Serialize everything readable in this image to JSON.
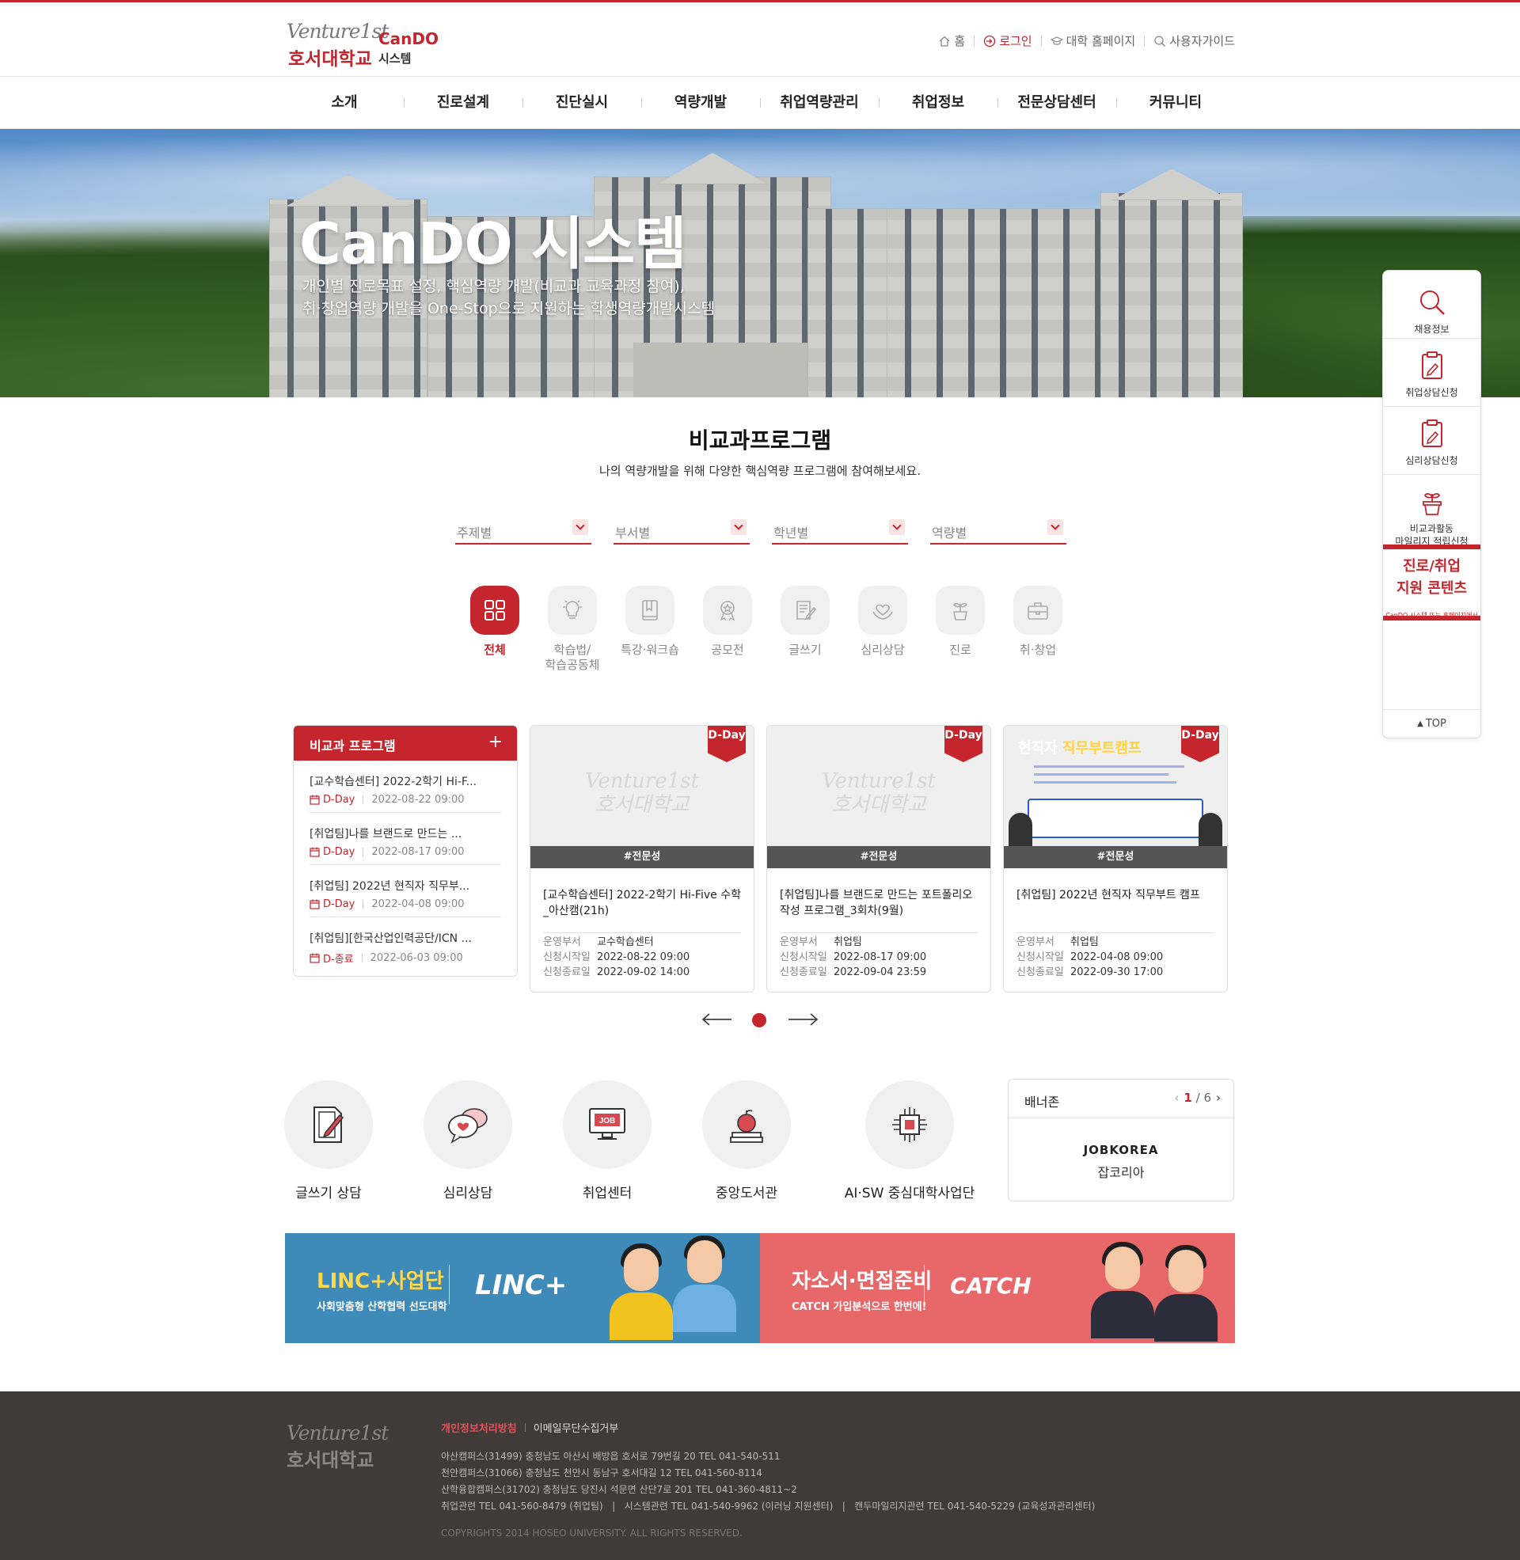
{
  "header": {
    "logo_venture": "Venture1st",
    "logo_univ": "호서대학교",
    "logo_cando": "CanDO",
    "logo_system": "시스템",
    "util": [
      {
        "label": "홈",
        "icon": "home-icon"
      },
      {
        "label": "로그인",
        "icon": "login-icon",
        "active": true
      },
      {
        "label": "대학 홈페이지",
        "icon": "graduation-cap-icon"
      },
      {
        "label": "사용자가이드",
        "icon": "search-icon"
      }
    ]
  },
  "gnb": [
    "소개",
    "진로설계",
    "진단실시",
    "역량개발",
    "취업역량관리",
    "취업정보",
    "전문상담센터",
    "커뮤니티"
  ],
  "hero": {
    "title": "CanDO 시스템",
    "sub1": "개인별 진로목표 설정, 핵심역량 개발(비교과 교육과정 참여),",
    "sub2": "취·창업역량 개발을 One-Stop으로 지원하는 학생역량개발시스템"
  },
  "program": {
    "title": "비교과프로그램",
    "subtitle": "나의 역량개발을 위해 다양한 핵심역량 프로그램에 참여해보세요.",
    "filters": [
      "주제별",
      "부서별",
      "학년별",
      "역량별"
    ],
    "categories": [
      {
        "label": "전체",
        "icon": "grid-icon",
        "active": true
      },
      {
        "label": "학습법/\n학습공동체",
        "icon": "lightbulb-icon"
      },
      {
        "label": "특강·워크숍",
        "icon": "book-icon"
      },
      {
        "label": "공모전",
        "icon": "award-icon"
      },
      {
        "label": "글쓰기",
        "icon": "writing-icon"
      },
      {
        "label": "심리상담",
        "icon": "heart-hands-icon"
      },
      {
        "label": "진로",
        "icon": "sprout-icon"
      },
      {
        "label": "취·창업",
        "icon": "briefcase-icon"
      }
    ],
    "list": {
      "title": "비교과 프로그램",
      "items": [
        {
          "title": "[교수학습센터] 2022-2학기 Hi-F...",
          "status": "D-Day",
          "date": "2022-08-22 09:00"
        },
        {
          "title": "[취업팀]나를 브랜드로 만드는 ...",
          "status": "D-Day",
          "date": "2022-08-17 09:00"
        },
        {
          "title": "[취업팀] 2022년 현직자 직무부...",
          "status": "D-Day",
          "date": "2022-04-08 09:00"
        },
        {
          "title": "[취업팀][한국산업인력공단/ICN ...",
          "status": "D-종료",
          "date": "2022-06-03 09:00"
        }
      ]
    },
    "cards": [
      {
        "badge": "D-Day",
        "tag": "#전문성",
        "title": "[교수학습센터] 2022-2학기 Hi-Five 수학_아산캠(21h)",
        "dept_label": "운영부서",
        "dept": "교수학습센터",
        "start_label": "신청시작일",
        "start": "2022-08-22 09:00",
        "end_label": "신청종료일",
        "end": "2022-09-02 14:00",
        "watermark1": "Venture1st",
        "watermark2": "호서대학교"
      },
      {
        "badge": "D-Day",
        "tag": "#전문성",
        "title": "[취업팀]나를 브랜드로 만드는 포트폴리오 작성 프로그램_3회차(9월)",
        "dept_label": "운영부서",
        "dept": "취업팀",
        "start_label": "신청시작일",
        "start": "2022-08-17 09:00",
        "end_label": "신청종료일",
        "end": "2022-09-04 23:59",
        "watermark1": "Venture1st",
        "watermark2": "호서대학교"
      },
      {
        "badge": "D-Day",
        "tag": "#전문성",
        "title": "[취업팀] 2022년 현직자 직무부트 캠프",
        "dept_label": "운영부서",
        "dept": "취업팀",
        "start_label": "신청시작일",
        "start": "2022-04-08 09:00",
        "end_label": "신청종료일",
        "end": "2022-09-30 17:00",
        "poster_title": "현직자",
        "poster_title2": "직무부트캠프"
      }
    ]
  },
  "quick": [
    {
      "label": "글쓰기 상담",
      "icon": "writing-doc-icon"
    },
    {
      "label": "심리상담",
      "icon": "chat-heart-icon"
    },
    {
      "label": "취업센터",
      "icon": "job-monitor-icon"
    },
    {
      "label": "중앙도서관",
      "icon": "apple-books-icon"
    },
    {
      "label": "AI·SW 중심대학사업단",
      "icon": "chip-icon"
    }
  ],
  "banner_zone": {
    "title": "배너존",
    "current": "1",
    "total": "6",
    "logo": "JOBKOREA",
    "name": "잡코리아"
  },
  "banners": [
    {
      "title": "LINC+사업단",
      "sub": "사회맞춤형 산학협력 선도대학",
      "logo": "LINC+",
      "bg": "#3e8ab8",
      "title_color": "#ffd94a"
    },
    {
      "title": "자소서·면접준비",
      "sub": "CATCH 가입분석으로 한번에!",
      "logo": "CATCH",
      "bg": "#e8686a",
      "title_color": "#ffffff"
    }
  ],
  "quickbar": {
    "items": [
      {
        "label": "채용정보",
        "icon": "search-icon"
      },
      {
        "label": "취업상담신청",
        "icon": "clipboard-pen-icon"
      },
      {
        "label": "심리상담신청",
        "icon": "clipboard-pen-icon"
      },
      {
        "label": "비교과활동\n마일리지 적립신청",
        "icon": "plant-pot-icon"
      }
    ],
    "banner_line1": "진로/취업",
    "banner_line2": "지원 콘텐츠",
    "banner_small": "CanDO 시스템 또는 홈페이지에서",
    "top": "TOP"
  },
  "footer": {
    "logo1": "Venture1st",
    "logo2": "호서대학교",
    "privacy": "개인정보처리방침",
    "email": "이메일무단수집거부",
    "addr1": "아산캠퍼스(31499) 충청남도 아산시 배방읍 호서로 79번길 20 TEL 041-540-511",
    "addr2": "천안캠퍼스(31066) 충청남도 천안시 동남구 호서대길 12 TEL 041-560-8114",
    "addr3": "산학융합캠퍼스(31702) 충청남도 당진시 석문면 산단7로 201 TEL 041-360-4811~2",
    "contact": "취업관련 TEL 041-560-8479 (취업팀)   |   시스템관련 TEL 041-540-9962 (이러닝 지원센터)   |   캔두마일리지관련 TEL 041-540-5229 (교육성과관리센터)",
    "copyright": "COPYRIGHTS 2014 HOSEO UNIVERSITY. ALL RIGHTS RESERVED."
  },
  "colors": {
    "primary": "#c5252d",
    "footer_bg": "#403a39"
  }
}
